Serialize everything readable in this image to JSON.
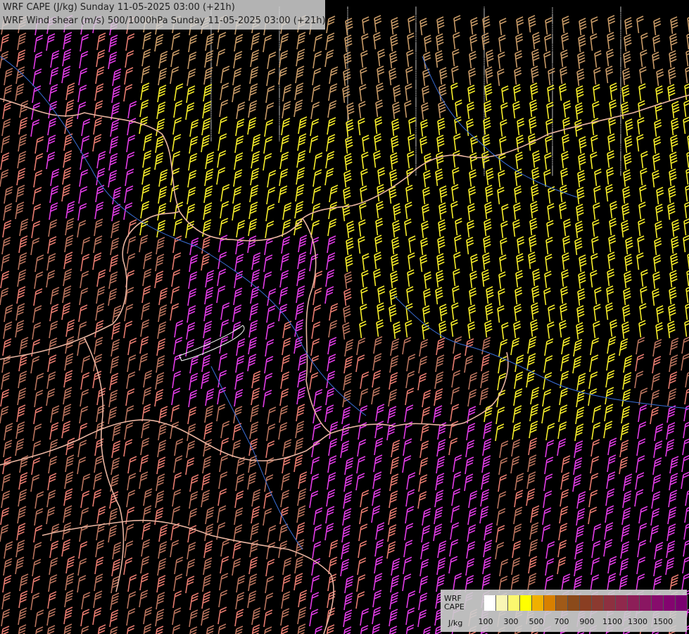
{
  "header": {
    "line1": "WRF CAPE (J/kg) Sunday 11-05-2025 03:00 (+21h)",
    "line2": "WRF Wind shear (m/s) 500/1000hPa Sunday 11-05-2025 03:00 (+21h)"
  },
  "legend": {
    "title_line1": "WRF",
    "title_line2": "CAPE",
    "unit": "J/kg",
    "swatch_colors": [
      "#ffffff",
      "#f9f6b5",
      "#fbf76e",
      "#ffff00",
      "#f0b000",
      "#d88000",
      "#a05a18",
      "#8b4a1a",
      "#8a3e22",
      "#8b3a30",
      "#8d3040",
      "#8f284c",
      "#8d1e58",
      "#8a1662",
      "#870c6c",
      "#83046f",
      "#7a0070"
    ],
    "tick_labels": [
      "100",
      "300",
      "500",
      "700",
      "900",
      "1100",
      "1300",
      "1500"
    ]
  },
  "colors": {
    "background": "#000000",
    "border_line": "#e8b4a0",
    "river_line": "#3a6fd8",
    "barb_magenta": "#e23be6",
    "barb_salmon": "#e77b6f",
    "barb_brown": "#b9735d",
    "barb_tan": "#c89a66",
    "barb_yellow": "#f5ec2a",
    "barb_grey": "#c58d7f"
  }
}
